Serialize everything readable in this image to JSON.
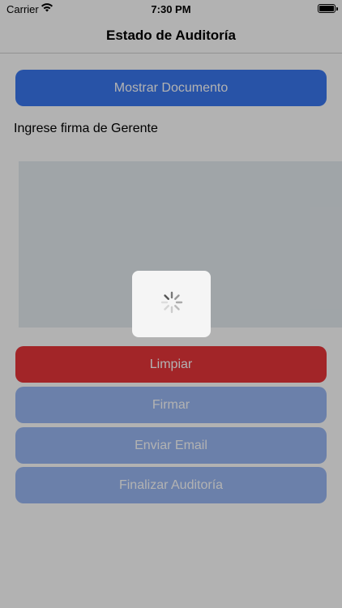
{
  "status_bar": {
    "carrier": "Carrier",
    "time": "7:30 PM",
    "icons": [
      "wifi-icon",
      "battery-icon"
    ]
  },
  "nav": {
    "title": "Estado de Auditoría"
  },
  "buttons": {
    "show_document": "Mostrar Documento",
    "clear": "Limpiar",
    "sign": "Firmar",
    "send_email": "Enviar Email",
    "finish_audit": "Finalizar Auditoría"
  },
  "signature": {
    "label": "Ingrese firma de Gerente"
  },
  "loading": {
    "icon": "activity-spinner-icon"
  },
  "colors": {
    "primary": "#3a77f0",
    "primary_disabled": "#9ab8f4",
    "danger": "#e8353a",
    "signature_bg": "#e6ecf1"
  }
}
